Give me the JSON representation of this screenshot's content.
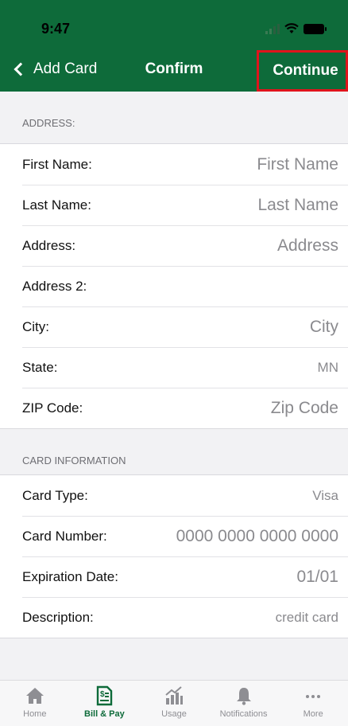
{
  "status_bar": {
    "time": "9:47"
  },
  "nav": {
    "back_label": "Add Card",
    "title": "Confirm",
    "continue_label": "Continue"
  },
  "address": {
    "header": "ADDRESS:",
    "rows": [
      {
        "label": "First Name:",
        "value": "First Name"
      },
      {
        "label": "Last Name:",
        "value": "Last Name"
      },
      {
        "label": "Address:",
        "value": "Address"
      },
      {
        "label": "Address 2:",
        "value": ""
      },
      {
        "label": "City:",
        "value": "City"
      },
      {
        "label": "State:",
        "value": "MN"
      },
      {
        "label": "ZIP Code:",
        "value": "Zip Code"
      }
    ]
  },
  "card": {
    "header": "CARD INFORMATION",
    "rows": [
      {
        "label": "Card Type:",
        "value": "Visa"
      },
      {
        "label": "Card Number:",
        "value": "0000 0000 0000 0000"
      },
      {
        "label": "Expiration Date:",
        "value": "01/01"
      },
      {
        "label": "Description:",
        "value": "credit card"
      }
    ]
  },
  "tabs": [
    {
      "label": "Home",
      "icon": "home-icon"
    },
    {
      "label": "Bill & Pay",
      "icon": "bill-icon",
      "active": true
    },
    {
      "label": "Usage",
      "icon": "usage-chart-icon"
    },
    {
      "label": "Notifications",
      "icon": "bell-icon"
    },
    {
      "label": "More",
      "icon": "more-icon"
    }
  ],
  "colors": {
    "brand_green": "#0e6b3a",
    "highlight_red": "#e0141c"
  }
}
